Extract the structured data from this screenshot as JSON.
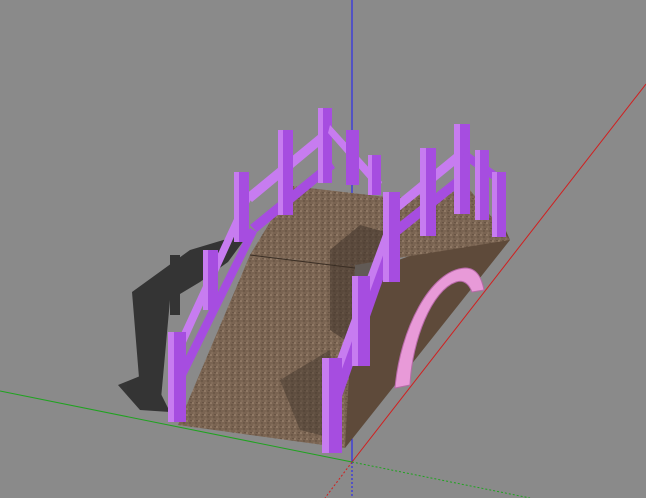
{
  "viewport": {
    "background_color": "#8a8a8a",
    "axis_colors": {
      "x": "#d11f1f",
      "y": "#1fa31f",
      "z": "#1a1aff"
    }
  },
  "model": {
    "deck_color": "#7a6452",
    "deck_shadow_color": "#3f332a",
    "railing_color": "#a64de0",
    "railing_light_color": "#c77cf0",
    "railing_dark_color": "#6a2aa3",
    "arch_color": "#e89ad8",
    "arch_dark_color": "#b86aa8",
    "ground_shadow_color": "#262626"
  }
}
